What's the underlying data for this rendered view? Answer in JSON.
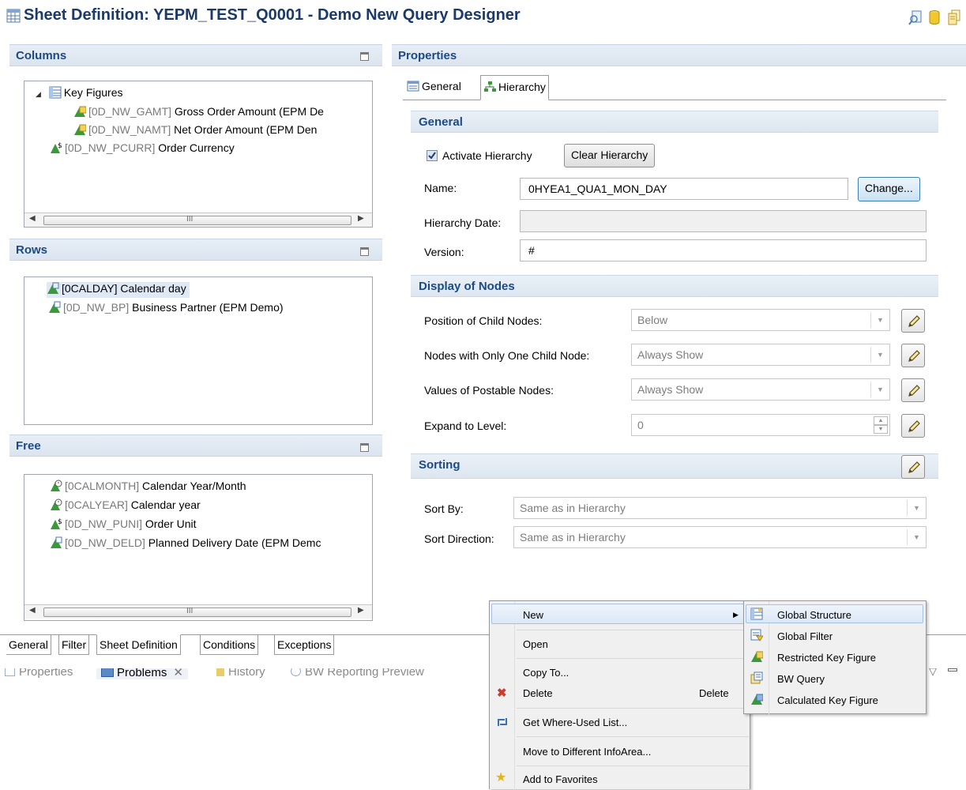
{
  "title": {
    "text": "Sheet Definition: YEPM_TEST_Q0001 - Demo New Query Designer"
  },
  "columns": {
    "header": "Columns",
    "items": [
      {
        "code": "",
        "label": "Key Figures"
      },
      {
        "code": "[0D_NW_GAMT]",
        "label": " Gross Order Amount (EPM De"
      },
      {
        "code": "[0D_NW_NAMT]",
        "label": " Net Order Amount (EPM Den"
      },
      {
        "code": "[0D_NW_PCURR]",
        "label": " Order Currency"
      }
    ],
    "scroll_marker": "III"
  },
  "rows": {
    "header": "Rows",
    "items": [
      {
        "code": "",
        "label": "[0CALDAY] Calendar day"
      },
      {
        "code": "[0D_NW_BP]",
        "label": " Business Partner (EPM Demo)"
      }
    ]
  },
  "free": {
    "header": "Free",
    "items": [
      {
        "code": "[0CALMONTH]",
        "label": " Calendar Year/Month"
      },
      {
        "code": "[0CALYEAR]",
        "label": " Calendar year"
      },
      {
        "code": "[0D_NW_PUNI]",
        "label": " Order Unit"
      },
      {
        "code": "[0D_NW_DELD]",
        "label": " Planned Delivery Date (EPM Demc"
      }
    ],
    "scroll_marker": "III"
  },
  "properties": {
    "header": "Properties",
    "tabs": [
      "General",
      "Hierarchy"
    ],
    "general": {
      "header": "General",
      "activate_label": "Activate Hierarchy",
      "activate_checked": true,
      "clear_button": "Clear Hierarchy",
      "name_label": "Name:",
      "name_value": "0HYEA1_QUA1_MON_DAY",
      "change_button": "Change...",
      "date_label": "Hierarchy Date:",
      "date_value": "",
      "version_label": "Version:",
      "version_value": "#"
    },
    "display": {
      "header": "Display of Nodes",
      "position_label": "Position of Child Nodes:",
      "position_value": "Below",
      "onechild_label": "Nodes with Only One Child Node:",
      "onechild_value": "Always Show",
      "postable_label": "Values of Postable Nodes:",
      "postable_value": "Always Show",
      "expand_label": "Expand to Level:",
      "expand_value": "0"
    },
    "sorting": {
      "header": "Sorting",
      "sortby_label": "Sort By:",
      "sortby_value": "Same as in Hierarchy",
      "direction_label": "Sort Direction:",
      "direction_value": "Same as in Hierarchy"
    }
  },
  "bottom_tabs": [
    "General",
    "Filter",
    "Sheet Definition",
    "Conditions",
    "Exceptions"
  ],
  "views": [
    "Properties",
    "Problems",
    "History",
    "BW Reporting Preview"
  ],
  "context_menu": {
    "items": [
      {
        "label": "New",
        "shortcut": ""
      },
      {
        "label": "Open",
        "shortcut": ""
      },
      {
        "label": "Copy To...",
        "shortcut": ""
      },
      {
        "label": "Delete",
        "shortcut": "Delete"
      },
      {
        "label": "Get Where-Used List...",
        "shortcut": ""
      },
      {
        "label": "Move to Different InfoArea...",
        "shortcut": ""
      },
      {
        "label": "Add to Favorites",
        "shortcut": ""
      }
    ]
  },
  "submenu": {
    "items": [
      "Global Structure",
      "Global Filter",
      "Restricted Key Figure",
      "BW Query",
      "Calculated Key Figure"
    ]
  }
}
